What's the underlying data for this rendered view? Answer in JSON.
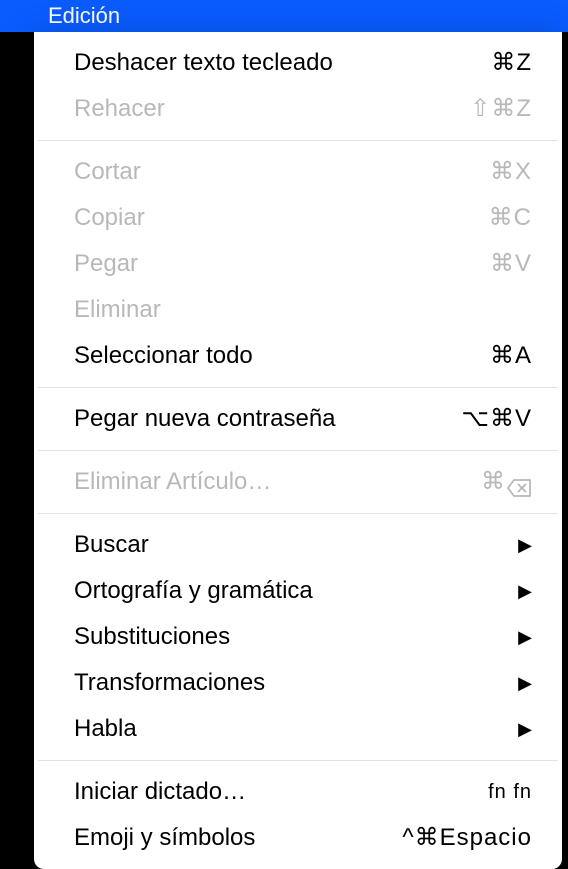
{
  "menubar": {
    "title": "Edición"
  },
  "menu": {
    "items": [
      {
        "label": "Deshacer texto tecleado",
        "shortcut": "⌘Z",
        "enabled": true
      },
      {
        "label": "Rehacer",
        "shortcut": "⇧⌘Z",
        "enabled": false
      }
    ],
    "edit_items": [
      {
        "label": "Cortar",
        "shortcut": "⌘X",
        "enabled": false
      },
      {
        "label": "Copiar",
        "shortcut": "⌘C",
        "enabled": false
      },
      {
        "label": "Pegar",
        "shortcut": "⌘V",
        "enabled": false
      },
      {
        "label": "Eliminar",
        "shortcut": "",
        "enabled": false
      },
      {
        "label": "Seleccionar todo",
        "shortcut": "⌘A",
        "enabled": true
      }
    ],
    "paste_password": {
      "label": "Pegar nueva contraseña",
      "shortcut": "⌥⌘V",
      "enabled": true
    },
    "delete_article": {
      "label": "Eliminar Artículo…",
      "shortcut_prefix": "⌘",
      "enabled": false
    },
    "submenu_items": [
      {
        "label": "Buscar",
        "enabled": true
      },
      {
        "label": "Ortografía y gramática",
        "enabled": true
      },
      {
        "label": "Substituciones",
        "enabled": true
      },
      {
        "label": "Transformaciones",
        "enabled": true
      },
      {
        "label": "Habla",
        "enabled": true
      }
    ],
    "bottom_items": [
      {
        "label": "Iniciar dictado…",
        "shortcut": "fn fn",
        "enabled": true
      },
      {
        "label": "Emoji y símbolos",
        "shortcut": "^⌘Espacio",
        "enabled": true
      }
    ]
  }
}
